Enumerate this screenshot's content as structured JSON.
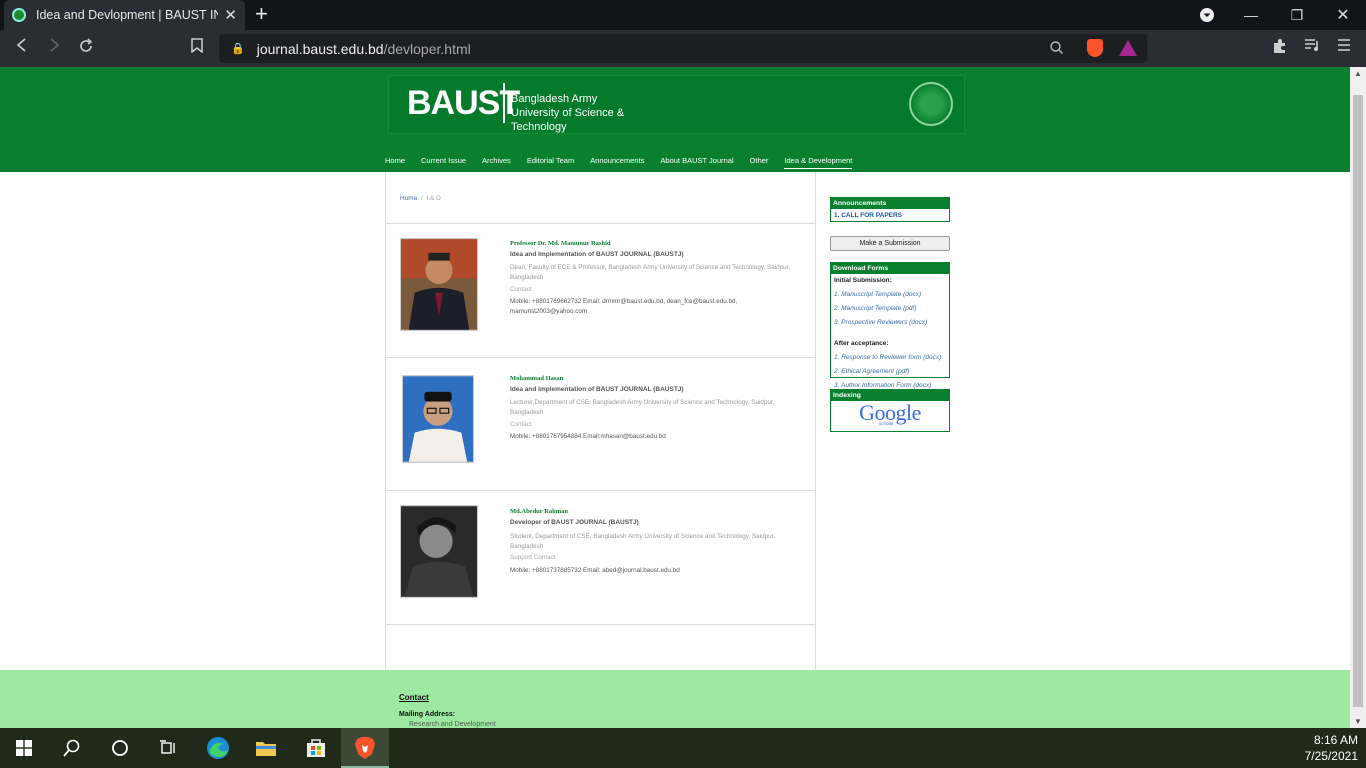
{
  "browser": {
    "tab_title": "Idea and Devlopment | BAUST INT",
    "new_tab": "+",
    "url_host": "journal.baust.edu.bd",
    "url_path": "/devloper.html"
  },
  "site": {
    "logo_text": "BAUST",
    "university_name": "Bangladesh Army University of Science & Technology",
    "nav": [
      "Home",
      "Current Issue",
      "Archives",
      "Editorial Team",
      "Announcements",
      "About BAUST Journal",
      "Other",
      "Idea & Development"
    ],
    "breadcrumb_home": "Home",
    "breadcrumb_sep": "/",
    "breadcrumb_current": "I & D"
  },
  "people": [
    {
      "name": "Professor Dr. Md. Mamunur Rashid",
      "role": "Idea and Implementation of BAUST JOURNAL (BAUSTJ)",
      "desc": "Dean, Faculty of ECE & Professor, Bangladesh Army University of Science and Technology, Saidpur, Bangladesh",
      "contact_label": "Contact",
      "mobile": "Mobile: +8801769662732 Email: drmmr@baust.edu.bd, dean_fce@baust.edu.bd, mamunst2003@yahoo.com"
    },
    {
      "name": "Mohammad Hasan",
      "role": "Idea and Implementation of BAUST JOURNAL (BAUSTJ)",
      "desc": "Lecturer,Department of CSE, Bangladesh Army University of Science and Technology, Saidpur, Bangladesh",
      "contact_label": "Contact",
      "mobile": "Mobile: +8801767954884 Email:mhasan@baust.edu.bd"
    },
    {
      "name": "Md.Abedur Rahman",
      "role": "Developer of BAUST JOURNAL (BAUSTJ)",
      "desc": "Student, Department of CSE, Bangladesh Army University of Science and Technology, Saidpur, Bangladesh",
      "contact_label": "Support Contact",
      "mobile": "Mobile: +8801737885732 Email: abed@journal.baust.edu.bd"
    }
  ],
  "sidebar": {
    "announcements_title": "Announcements",
    "announcement_1": "1. CALL FOR PAPERS",
    "submit_label": "Make a Submission",
    "forms_title": "Download Forms",
    "initial_title": "Initial Submission:",
    "initial_items": [
      "1. Manuscript Template (docx)",
      "2. Manuscript Template (pdf)",
      "3. Prospective Reviewers (docx)"
    ],
    "after_title": "After acceptance:",
    "after_items": [
      "1. Response to Reviewer form (docx)",
      "2. Ethical Agreement (pdf)",
      "3. Author Information Form (docx)"
    ],
    "indexing_title": "Indexing",
    "google_text": "Google",
    "scholar_text": "scholar"
  },
  "footer": {
    "contact": "Contact",
    "mailing": "Mailing Address:",
    "rnd": "Research and Development"
  },
  "taskbar": {
    "time": "8:16 AM",
    "date": "7/25/2021"
  },
  "colors": {
    "brand_green": "#0a7f2e",
    "footer_green": "#9de9a1",
    "link_blue": "#3a6ea5"
  }
}
